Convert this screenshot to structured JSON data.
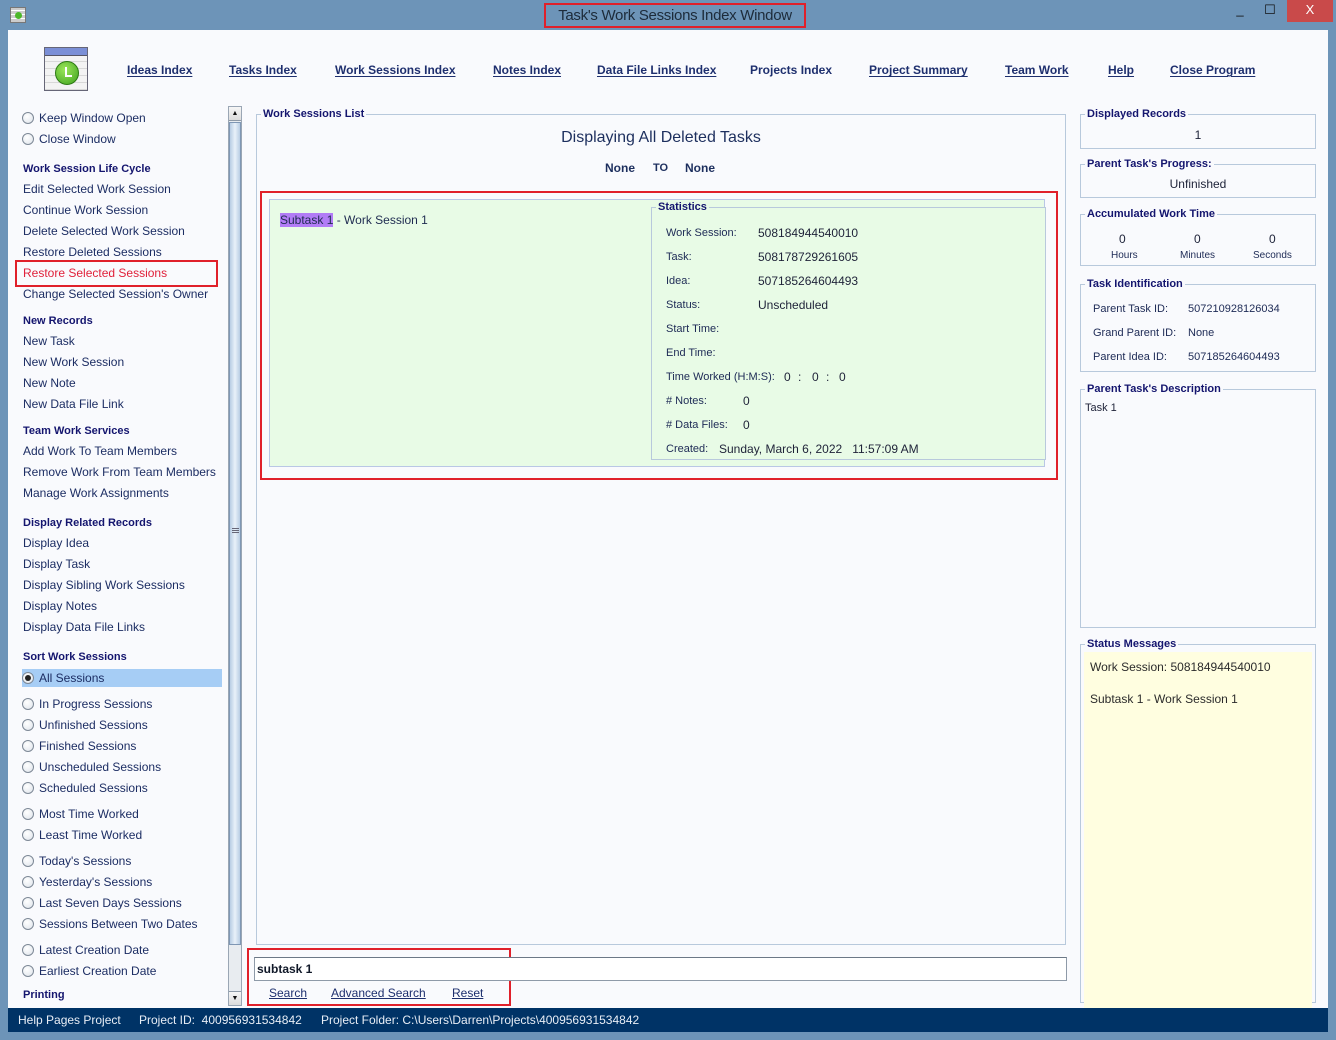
{
  "window": {
    "title": "Task's Work Sessions Index Window",
    "controls": {
      "minimize": "_",
      "maximize": "☐",
      "close": "X"
    }
  },
  "nav": {
    "items": [
      {
        "label": "Ideas Index"
      },
      {
        "label": "Tasks Index"
      },
      {
        "label": "Work Sessions Index"
      },
      {
        "label": "Notes Index"
      },
      {
        "label": "Data File Links Index"
      },
      {
        "label": "Projects Index"
      },
      {
        "label": "Project Summary"
      },
      {
        "label": "Team Work"
      },
      {
        "label": "Help"
      },
      {
        "label": "Close Program"
      }
    ]
  },
  "sidebar": {
    "window_options": [
      {
        "label": "Keep Window Open",
        "selected": false
      },
      {
        "label": "Close Window",
        "selected": false
      }
    ],
    "lifecycle": {
      "heading": "Work Session Life Cycle",
      "items": [
        {
          "label": "Edit Selected Work Session"
        },
        {
          "label": "Continue Work Session"
        },
        {
          "label": "Delete Selected Work Session"
        },
        {
          "label": "Restore Deleted Sessions"
        },
        {
          "label": "Restore Selected Sessions",
          "active": true
        },
        {
          "label": "Change Selected Session's Owner"
        }
      ]
    },
    "new_records": {
      "heading": "New Records",
      "items": [
        {
          "label": "New Task"
        },
        {
          "label": "New Work Session"
        },
        {
          "label": "New Note"
        },
        {
          "label": "New Data File Link"
        }
      ]
    },
    "team_work": {
      "heading": "Team Work Services",
      "items": [
        {
          "label": "Add Work To Team Members"
        },
        {
          "label": "Remove Work From Team Members"
        },
        {
          "label": "Manage Work Assignments"
        }
      ]
    },
    "related": {
      "heading": "Display Related Records",
      "items": [
        {
          "label": "Display Idea"
        },
        {
          "label": "Display Task"
        },
        {
          "label": "Display Sibling Work Sessions"
        },
        {
          "label": "Display Notes"
        },
        {
          "label": "Display Data File Links"
        }
      ]
    },
    "sort": {
      "heading": "Sort Work Sessions",
      "options": [
        {
          "label": "All Sessions",
          "selected": true
        },
        {
          "label": "In Progress Sessions"
        },
        {
          "label": "Unfinished Sessions"
        },
        {
          "label": "Finished Sessions"
        },
        {
          "label": "Unscheduled Sessions"
        },
        {
          "label": "Scheduled Sessions"
        },
        {
          "label": "Most Time Worked"
        },
        {
          "label": "Least Time Worked"
        },
        {
          "label": "Today's Sessions"
        },
        {
          "label": "Yesterday's Sessions"
        },
        {
          "label": "Last Seven Days Sessions"
        },
        {
          "label": "Sessions Between Two Dates"
        },
        {
          "label": "Latest Creation Date"
        },
        {
          "label": "Earliest Creation Date"
        }
      ]
    },
    "printing": {
      "heading": "Printing"
    }
  },
  "list": {
    "group_title": "Work Sessions List",
    "heading": "Displaying All Deleted Tasks",
    "range_from": "None",
    "range_to_label": "TO",
    "range_to": "None",
    "record": {
      "title_highlight": "Subtask 1",
      "title_rest": " - Work Session 1",
      "stats_title": "Statistics",
      "work_session_label": "Work Session:",
      "work_session": "508184944540010",
      "task_label": "Task:",
      "task": "508178729261605",
      "idea_label": "Idea:",
      "idea": "507185264604493",
      "status_label": "Status:",
      "status": "Unscheduled",
      "start_label": "Start Time:",
      "end_label": "End Time:",
      "time_worked_label": "Time Worked (H:M:S):",
      "hours": "0",
      "minutes": "0",
      "seconds": "0",
      "sep": ":",
      "notes_label": "# Notes:",
      "notes": "0",
      "data_files_label": "# Data Files:",
      "data_files": "0",
      "created_label": "Created:",
      "created": "Sunday, March 6, 2022   11:57:09 AM"
    }
  },
  "search": {
    "value": "subtask 1",
    "search_label": "Search",
    "advanced_label": "Advanced Search",
    "reset_label": "Reset"
  },
  "right": {
    "displayed_records": {
      "title": "Displayed Records",
      "value": "1"
    },
    "progress": {
      "title": "Parent Task's Progress:",
      "value": "Unfinished"
    },
    "work_time": {
      "title": "Accumulated Work Time",
      "hours": "0",
      "hours_label": "Hours",
      "minutes": "0",
      "minutes_label": "Minutes",
      "seconds": "0",
      "seconds_label": "Seconds"
    },
    "identification": {
      "title": "Task Identification",
      "parent_task_label": "Parent Task ID:",
      "parent_task": "507210928126034",
      "grand_parent_label": "Grand Parent ID:",
      "grand_parent": "None",
      "parent_idea_label": "Parent Idea ID:",
      "parent_idea": "507185264604493"
    },
    "description": {
      "title": "Parent Task's Description",
      "text": "Task 1"
    },
    "status_messages": {
      "title": "Status Messages",
      "lines": [
        "Work Session: 508184944540010",
        "Subtask 1 - Work Session 1"
      ]
    }
  },
  "statusbar": {
    "project": "Help Pages Project",
    "project_id": "Project ID:  400956931534842",
    "folder": "Project Folder: C:\\Users\\Darren\\Projects\\400956931534842"
  }
}
